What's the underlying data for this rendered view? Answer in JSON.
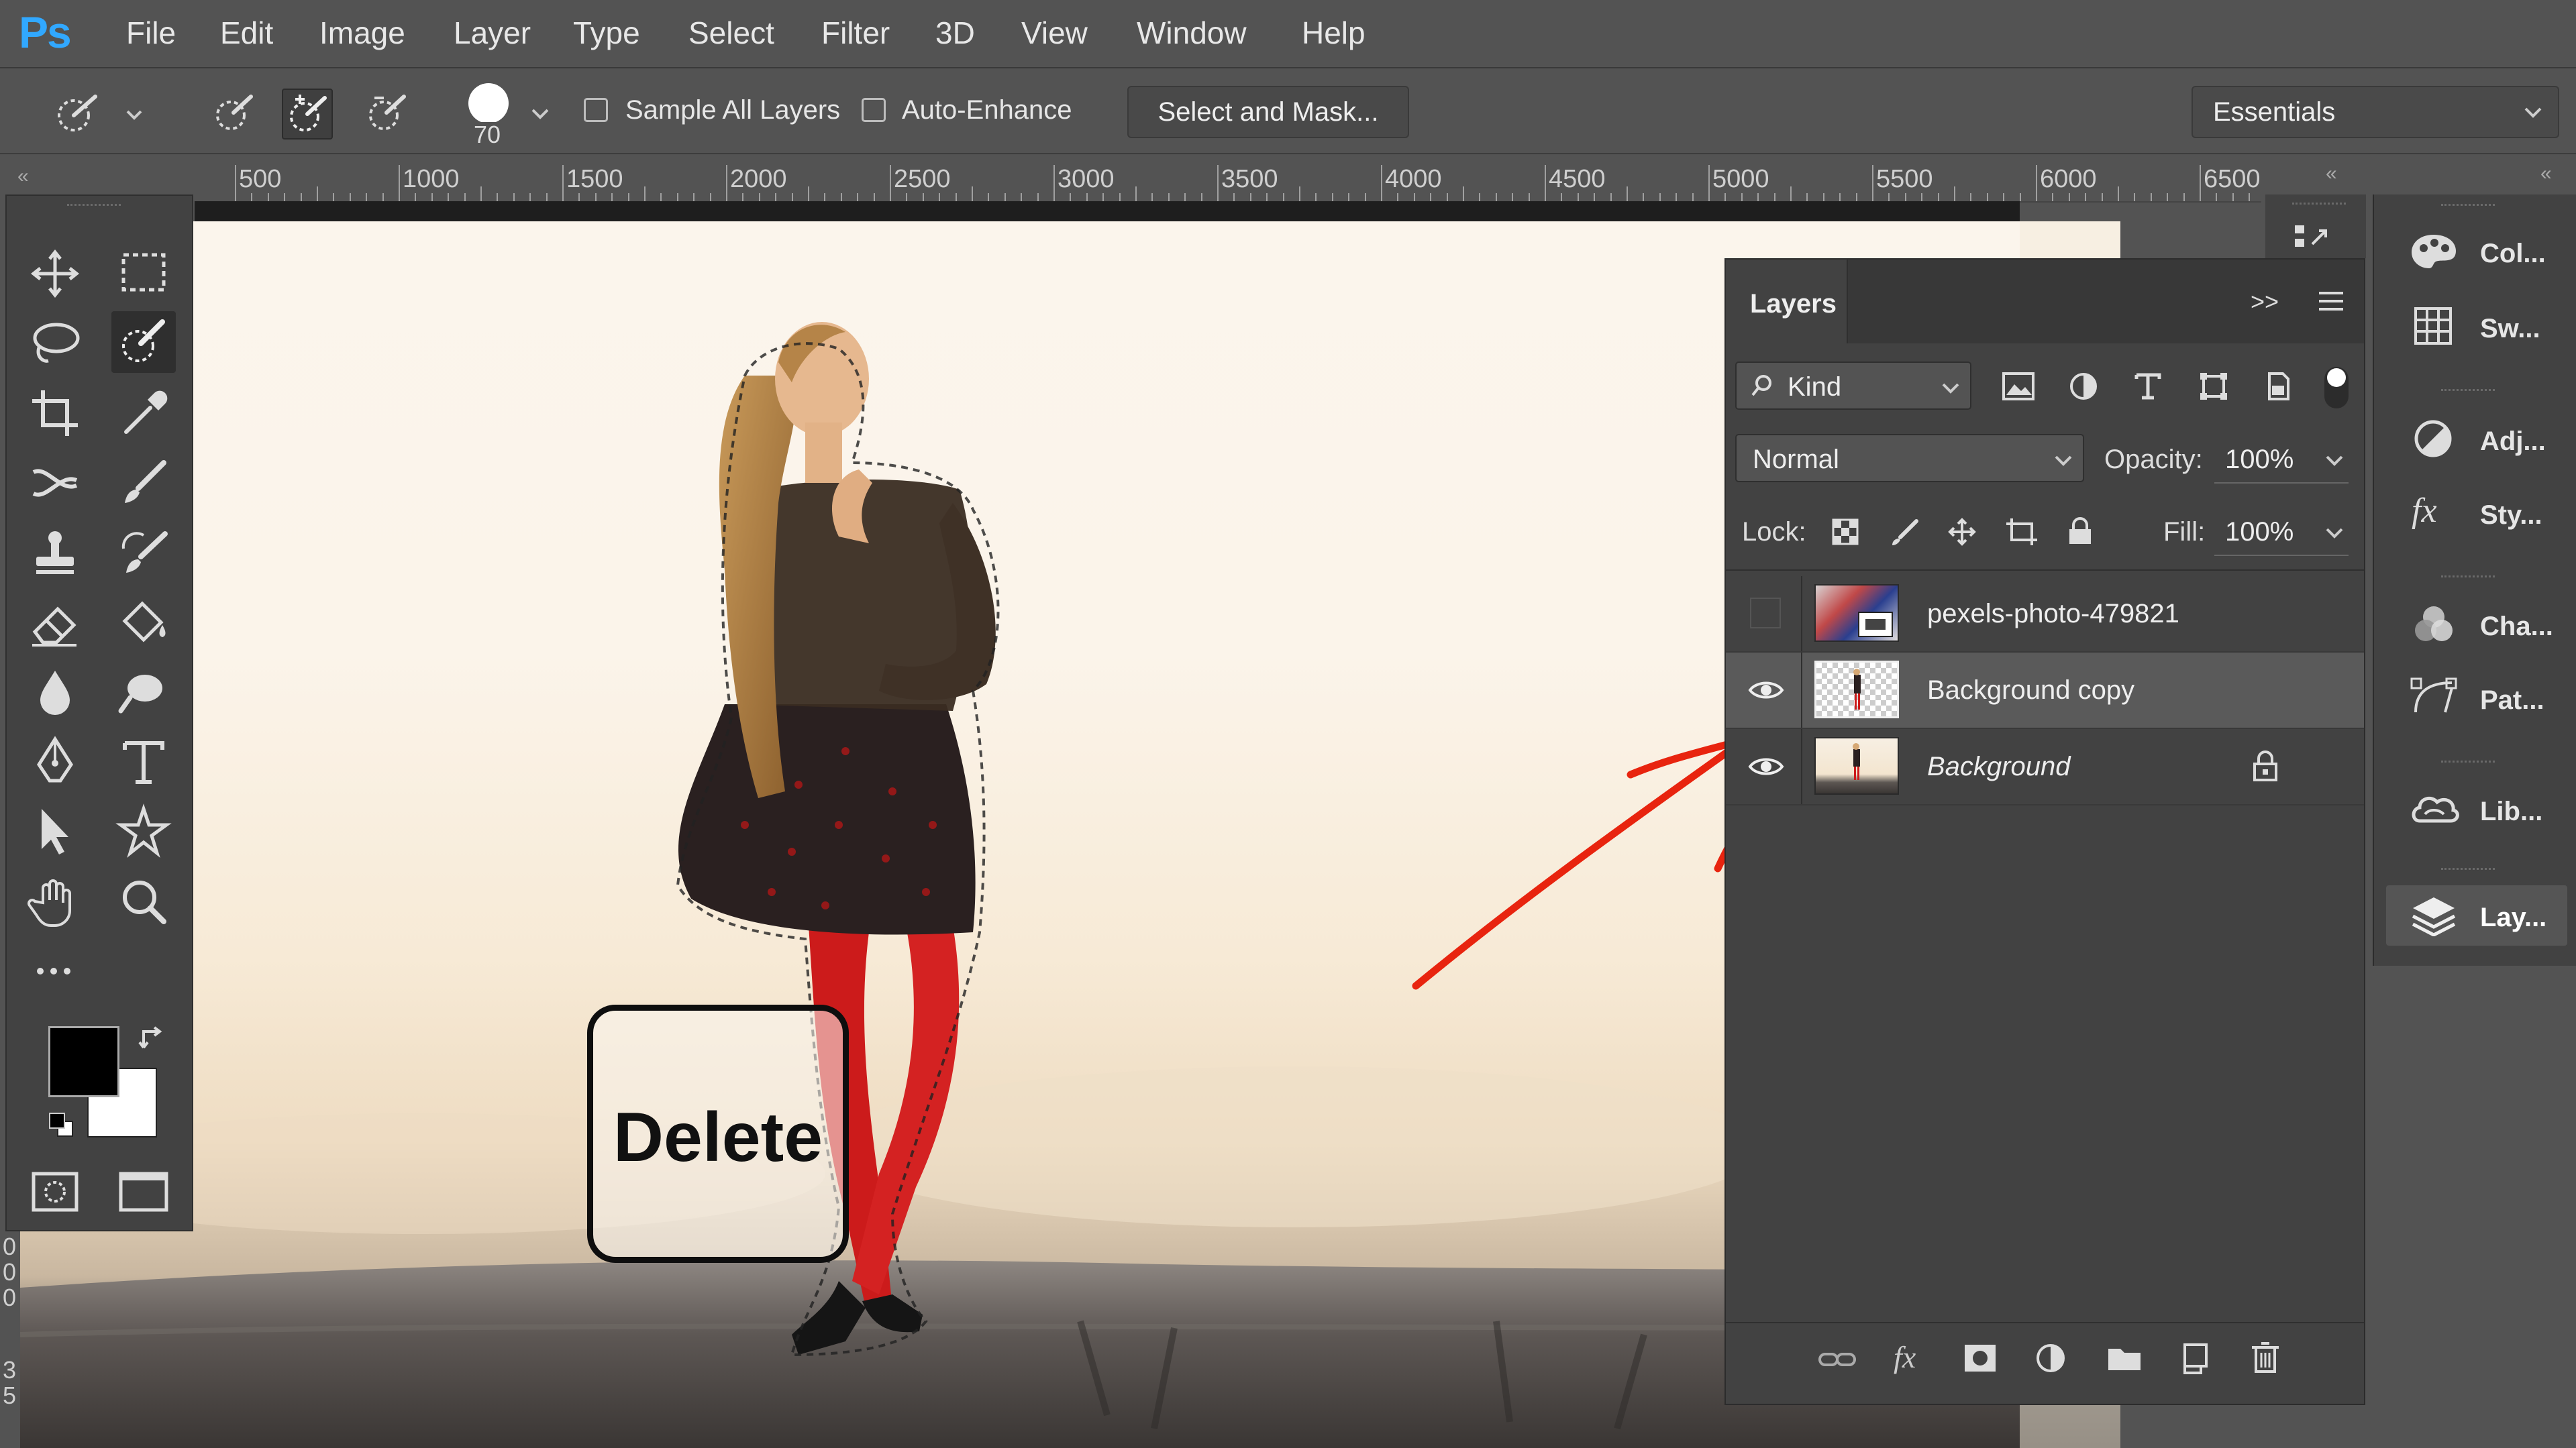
{
  "app": {
    "logo": "Ps",
    "menu": [
      "File",
      "Edit",
      "Image",
      "Layer",
      "Type",
      "Select",
      "Filter",
      "3D",
      "View",
      "Window",
      "Help"
    ]
  },
  "options_bar": {
    "brush_size": "70",
    "sample_all_layers_label": "Sample All Layers",
    "auto_enhance_label": "Auto-Enhance",
    "select_and_mask_label": "Select and Mask...",
    "workspace": "Essentials"
  },
  "ruler": {
    "ticks": [
      "500",
      "1000",
      "1500",
      "2000",
      "2500",
      "3000",
      "3500",
      "4000",
      "4500",
      "5000",
      "5500",
      "6000",
      "6500"
    ],
    "vertical_ticks": [
      "0",
      "0",
      "0",
      "3",
      "5"
    ]
  },
  "overlay": {
    "delete_key_label": "Delete"
  },
  "layers_panel": {
    "title": "Layers",
    "filter_kind": "Kind",
    "blend_mode": "Normal",
    "opacity_label": "Opacity:",
    "opacity_value": "100%",
    "lock_label": "Lock:",
    "fill_label": "Fill:",
    "fill_value": "100%",
    "layers": [
      {
        "name": "pexels-photo-479821",
        "visible": false,
        "selected": false,
        "locked": false
      },
      {
        "name": "Background copy",
        "visible": true,
        "selected": true,
        "locked": false
      },
      {
        "name": "Background",
        "visible": true,
        "selected": false,
        "locked": true
      }
    ]
  },
  "dock": {
    "items": [
      "Col...",
      "Sw...",
      "Adj...",
      "Sty...",
      "Cha...",
      "Pat...",
      "Lib...",
      "Lay..."
    ]
  },
  "colors": {
    "ui_background": "#535353",
    "panel": "#424242",
    "ps_blue": "#31a8ff",
    "annotation_red": "#e8240f",
    "foreground_color": "#000000",
    "background_color": "#ffffff"
  }
}
